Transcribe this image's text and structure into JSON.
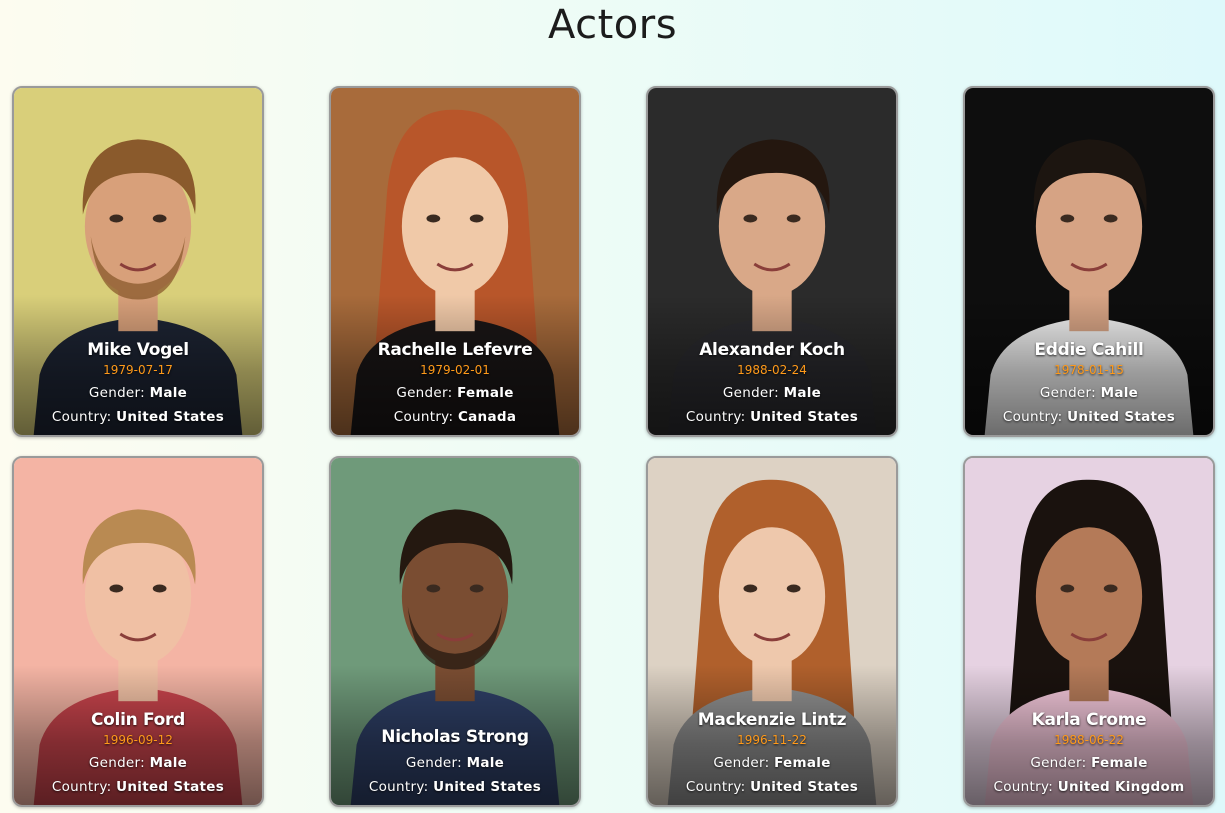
{
  "page": {
    "title": "Actors"
  },
  "labels": {
    "gender": "Gender:",
    "country": "Country:"
  },
  "actors": [
    {
      "name": "Mike Vogel",
      "birthday": "1979-07-17",
      "gender": "Male",
      "country": "United States",
      "photo": {
        "bg": "#d9cf7a",
        "skin": "#d8a07a",
        "hair": "#8a5a2c",
        "shirt": "#1d2433",
        "beard": true
      }
    },
    {
      "name": "Rachelle Lefevre",
      "birthday": "1979-02-01",
      "gender": "Female",
      "country": "Canada",
      "photo": {
        "bg": "#a86b3b",
        "skin": "#f0c9a8",
        "hair": "#b8562a",
        "shirt": "#1a1616",
        "longhair": true
      }
    },
    {
      "name": "Alexander Koch",
      "birthday": "1988-02-24",
      "gender": "Male",
      "country": "United States",
      "photo": {
        "bg": "#2b2b2b",
        "skin": "#d9a888",
        "hair": "#24170f",
        "shirt": "#2a2a2e"
      }
    },
    {
      "name": "Eddie Cahill",
      "birthday": "1978-01-15",
      "gender": "Male",
      "country": "United States",
      "photo": {
        "bg": "#0e0e0e",
        "skin": "#d6a384",
        "hair": "#1c1510",
        "shirt": "#f0f0f0"
      }
    },
    {
      "name": "Colin Ford",
      "birthday": "1996-09-12",
      "gender": "Male",
      "country": "United States",
      "photo": {
        "bg": "#f4b4a4",
        "skin": "#f0c0a4",
        "hair": "#b98a52",
        "shirt": "#c9444c"
      }
    },
    {
      "name": "Nicholas Strong",
      "birthday": "",
      "gender": "Male",
      "country": "United States",
      "photo": {
        "bg": "#6f9a7a",
        "skin": "#7a4d32",
        "hair": "#241810",
        "shirt": "#2e3f66",
        "beard": true
      }
    },
    {
      "name": "Mackenzie Lintz",
      "birthday": "1996-11-22",
      "gender": "Female",
      "country": "United States",
      "photo": {
        "bg": "#ddd2c4",
        "skin": "#eec8ac",
        "hair": "#b0602c",
        "shirt": "#8f8f8f",
        "longhair": true
      }
    },
    {
      "name": "Karla Crome",
      "birthday": "1988-06-22",
      "gender": "Female",
      "country": "United Kingdom",
      "photo": {
        "bg": "#e6d2e2",
        "skin": "#b47a58",
        "hair": "#1a120e",
        "shirt": "#f3c7da",
        "longhair": true
      }
    }
  ]
}
